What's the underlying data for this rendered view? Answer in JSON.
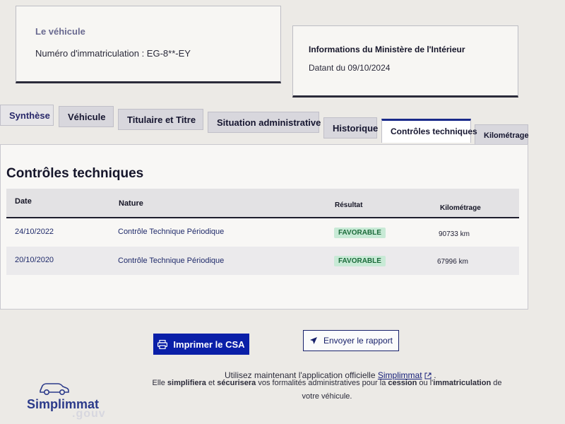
{
  "vehicle": {
    "title": "Le véhicule",
    "registration": "Numéro d'immatriculation : EG-8**-EY"
  },
  "ministry": {
    "title": "Informations du Ministère de l'Intérieur",
    "date": "Datant du 09/10/2024"
  },
  "tabs": [
    {
      "label": "Synthèse"
    },
    {
      "label": "Véhicule"
    },
    {
      "label": "Titulaire et Titre"
    },
    {
      "label": "Situation administrative"
    },
    {
      "label": "Historique"
    },
    {
      "label": "Contrôles techniques"
    },
    {
      "label": "Kilométrage"
    }
  ],
  "active_tab": "Contrôles techniques",
  "panel": {
    "title": "Contrôles techniques",
    "columns": [
      "Date",
      "Nature",
      "Résultat",
      "Kilométrage"
    ],
    "rows": [
      {
        "date": "24/10/2022",
        "nature": "Contrôle Technique Périodique",
        "result": "FAVORABLE",
        "km": "90733 km"
      },
      {
        "date": "20/10/2020",
        "nature": "Contrôle Technique Périodique",
        "result": "FAVORABLE",
        "km": "67996 km"
      }
    ]
  },
  "buttons": {
    "print": "Imprimer le CSA",
    "send": "Envoyer le rapport"
  },
  "footer": {
    "line1_prefix": "Utilisez maintenant l'application officielle",
    "line1_link": "Simplimmat",
    "line2_part1": "Elle",
    "line2_bold1": "simplifiera",
    "line2_part2": "et",
    "line2_bold2": "sécurisera",
    "line2_part3": "vos formalités administratives pour la",
    "line2_bold3": "cession",
    "line2_part4": "ou l'",
    "line2_bold4": "immatriculation",
    "line2_part5": "de votre véhicule."
  },
  "logo": {
    "word": "Simplimmat",
    "suffix": ".gouv"
  },
  "colors": {
    "primary": "#0a1fa8",
    "badge_bg": "#c8ead6",
    "badge_text": "#1b6b3a"
  }
}
